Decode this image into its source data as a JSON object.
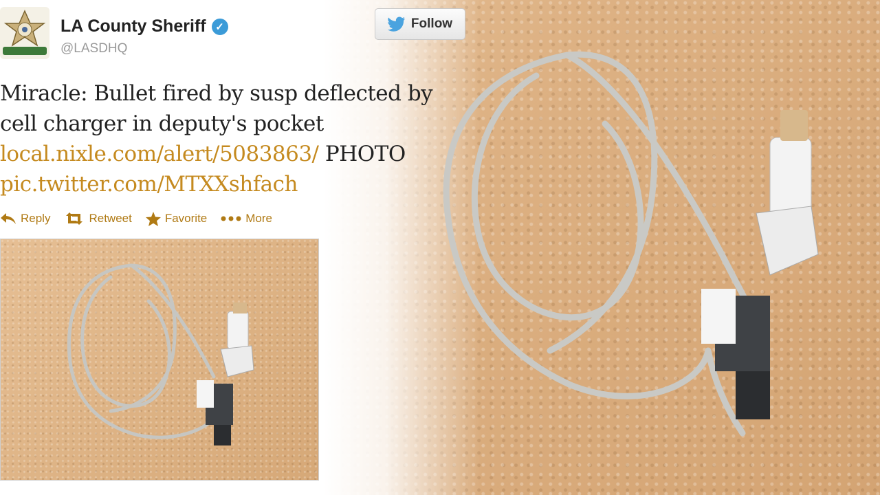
{
  "tweet": {
    "display_name": "LA County Sheriff",
    "handle": "@LASDHQ",
    "follow_label": "Follow",
    "text_lines": [
      "Miracle: Bullet fired by susp deflected by",
      "cell charger in deputy's pocket"
    ],
    "link1": "local.nixle.com/alert/5083863/",
    "link1_suffix": " PHOTO",
    "link2": "pic.twitter.com/MTXXshfach",
    "actions": {
      "reply": "Reply",
      "retweet": "Retweet",
      "favorite": "Favorite",
      "more": "More"
    }
  },
  "colors": {
    "link": "#c58a1f",
    "action": "#b07a14",
    "verified": "#3b9bd8",
    "twitter_bird": "#4aa3df"
  }
}
